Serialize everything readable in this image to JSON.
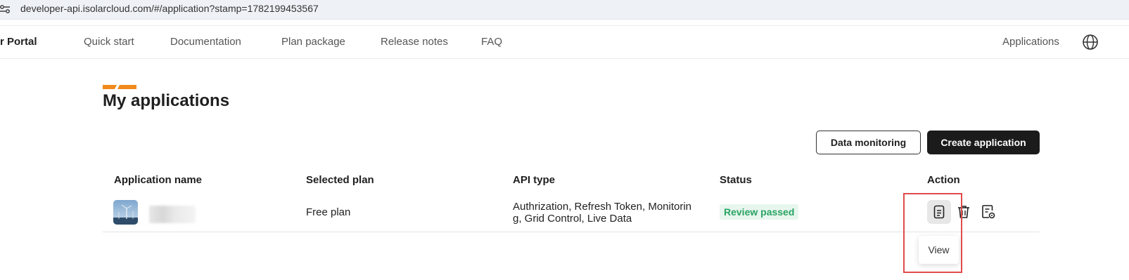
{
  "browser": {
    "url": "developer-api.isolarcloud.com/#/application?stamp=1782199453567",
    "site_icon": "tune-icon"
  },
  "nav": {
    "brand": "r Portal",
    "items": [
      "Quick start",
      "Documentation",
      "Plan package",
      "Release notes",
      "FAQ"
    ],
    "right_label": "Applications",
    "language_icon": "globe-icon"
  },
  "page": {
    "title": "My applications",
    "accent_color": "#f08a1c",
    "buttons": {
      "data_monitoring": "Data monitoring",
      "create_application": "Create application"
    }
  },
  "table": {
    "headers": [
      "Application name",
      "Selected plan",
      "API type",
      "Status",
      "Action"
    ],
    "rows": [
      {
        "selected_plan": "Free plan",
        "api_type": "Authrization, Refresh Token, Monitoring, Grid Control, Live Data",
        "status": "Review passed",
        "status_color": "#2aa463",
        "actions": [
          "view-icon",
          "delete-icon",
          "document-settings-icon"
        ]
      }
    ]
  },
  "tooltip": {
    "text": "View"
  },
  "annotation": {
    "highlight_color": "#e04b4b"
  }
}
